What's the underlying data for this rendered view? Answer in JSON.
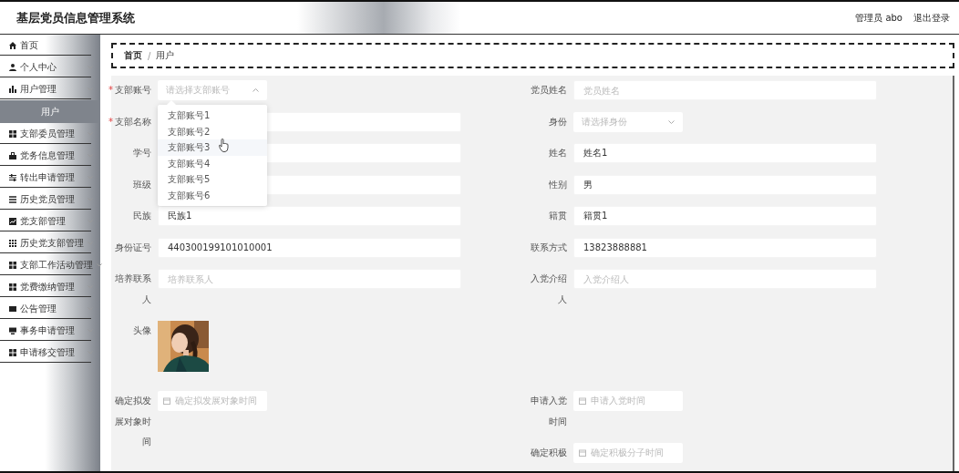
{
  "header": {
    "title": "基层党员信息管理系统",
    "user": "管理员 abo",
    "logout": "退出登录"
  },
  "sidebar": {
    "items": [
      {
        "label": "首页",
        "kind": "link"
      },
      {
        "label": "个人中心",
        "kind": "submenu"
      },
      {
        "label": "用户管理",
        "kind": "submenu",
        "children": [
          {
            "label": "用户",
            "selected": true
          }
        ]
      },
      {
        "label": "支部委员管理",
        "kind": "submenu"
      },
      {
        "label": "党务信息管理",
        "kind": "submenu"
      },
      {
        "label": "转出申请管理",
        "kind": "submenu"
      },
      {
        "label": "历史党员管理",
        "kind": "submenu"
      },
      {
        "label": "党支部管理",
        "kind": "submenu"
      },
      {
        "label": "历史党支部管理",
        "kind": "submenu"
      },
      {
        "label": "支部工作活动管理",
        "kind": "submenu"
      },
      {
        "label": "党费缴纳管理",
        "kind": "submenu"
      },
      {
        "label": "公告管理",
        "kind": "submenu"
      },
      {
        "label": "事务申请管理",
        "kind": "submenu"
      },
      {
        "label": "申请移交管理",
        "kind": "submenu"
      }
    ]
  },
  "breadcrumb": {
    "items": [
      "首页",
      "用户"
    ],
    "separator": "/"
  },
  "form": {
    "rows": [
      {
        "left": [
          {
            "kind": "select",
            "label": "支部账号",
            "required_mark": "*",
            "placeholder": "请选择支部账号",
            "open": true,
            "options": [
              {
                "label": "支部账号1",
                "hovered": false
              },
              {
                "label": "支部账号2",
                "hovered": false
              },
              {
                "label": "支部账号3",
                "hovered": true
              },
              {
                "label": "支部账号4",
                "hovered": false
              },
              {
                "label": "支部账号5",
                "hovered": false
              },
              {
                "label": "支部账号6",
                "hovered": false
              }
            ]
          }
        ],
        "right": [
          {
            "kind": "input",
            "label": "党员姓名",
            "placeholder": "党员姓名"
          }
        ]
      },
      {
        "left": [
          {
            "kind": "input",
            "label": "支部名称",
            "required_mark": "*"
          }
        ],
        "right": [
          {
            "kind": "select",
            "label": "身份",
            "placeholder": "请选择身份",
            "open": false
          }
        ]
      },
      {
        "left": [
          {
            "kind": "input",
            "label": "学号"
          }
        ],
        "right": [
          {
            "kind": "input",
            "label": "姓名",
            "value": "姓名1"
          }
        ]
      },
      {
        "left": [
          {
            "kind": "input",
            "label": "班级"
          }
        ],
        "right": [
          {
            "kind": "input",
            "label": "性别",
            "value": "男"
          }
        ]
      },
      {
        "left": [
          {
            "kind": "input",
            "label": "民族",
            "value": "民族1"
          }
        ],
        "right": [
          {
            "kind": "input",
            "label": "籍贯",
            "value": "籍贯1"
          }
        ]
      },
      {
        "left": [
          {
            "kind": "input",
            "label": "身份证号",
            "value": "440300199101010001"
          }
        ],
        "right": [
          {
            "kind": "input",
            "label": "联系方式",
            "value": "13823888881"
          }
        ]
      },
      {
        "left": [
          {
            "kind": "input",
            "label": "培养联系人",
            "placeholder": "培养联系人"
          }
        ],
        "right": [
          {
            "kind": "input",
            "label": "入党介绍人",
            "placeholder": "入党介绍人"
          }
        ]
      },
      {
        "left": [
          {
            "label": "头像"
          }
        ]
      },
      {
        "left": [
          {
            "kind": "date",
            "label": "确定拟发展对象时间",
            "placeholder": "确定拟发展对象时间"
          }
        ],
        "right": [
          {
            "kind": "date",
            "label": "申请入党时间",
            "placeholder": "申请入党时间"
          },
          {
            "kind": "date",
            "label": "确定积极",
            "placeholder": "确定积极分子时间"
          }
        ]
      }
    ]
  }
}
